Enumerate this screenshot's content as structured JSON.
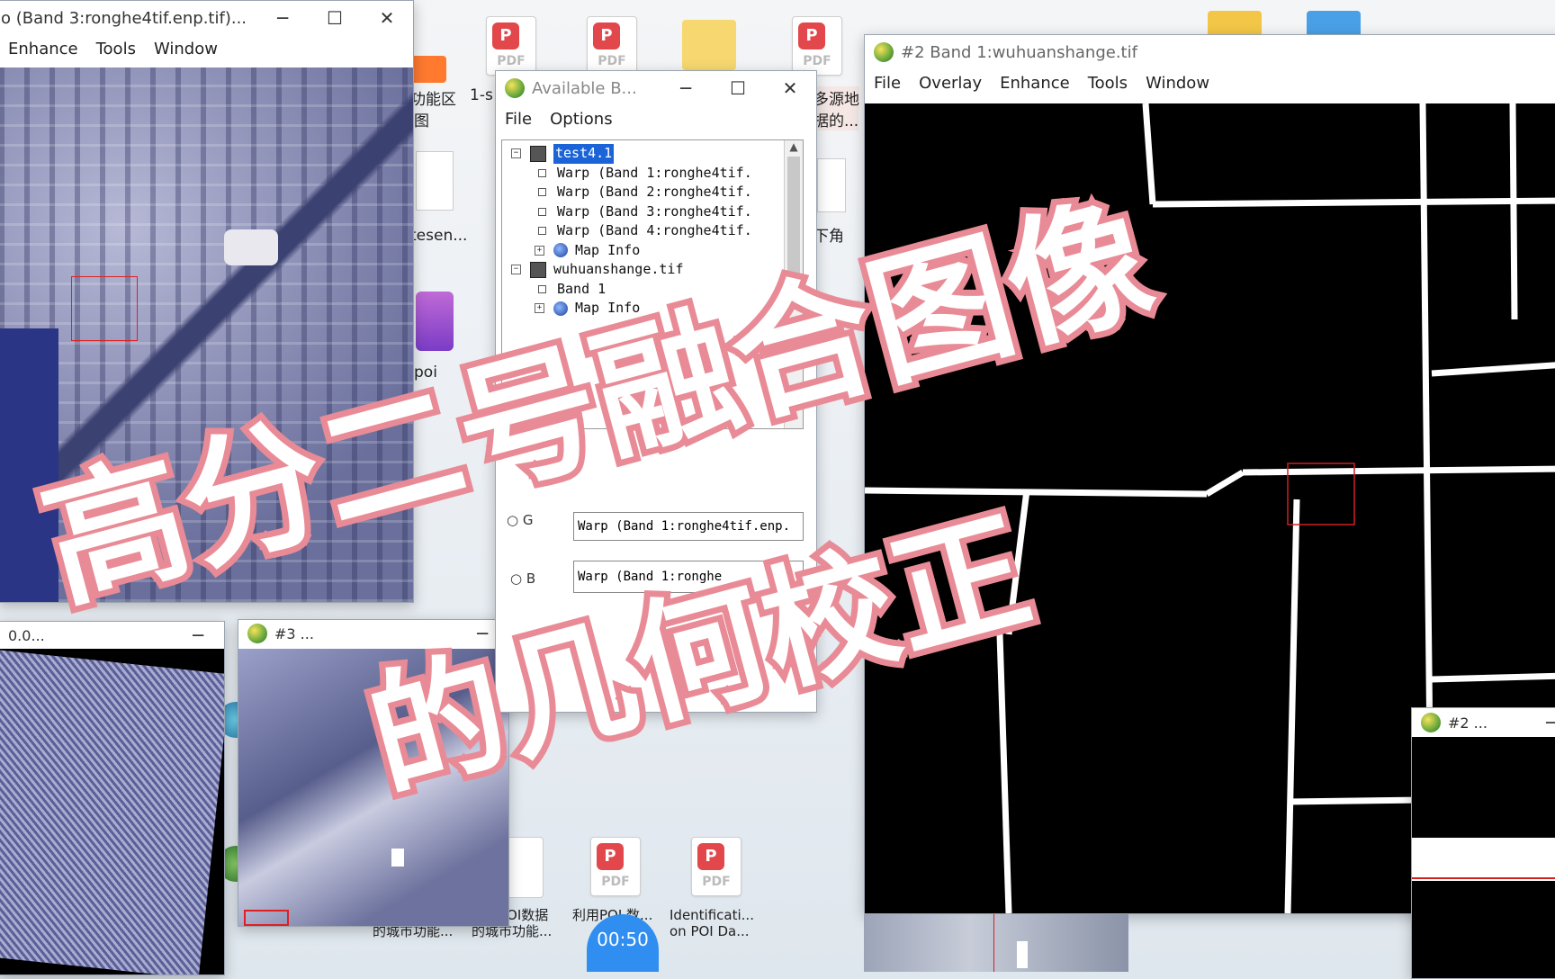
{
  "desktop": {
    "icons_top": [
      {
        "label": "1-s",
        "kind": "pdf"
      },
      {
        "label": "",
        "kind": "pdf"
      },
      {
        "label": "",
        "kind": "folder"
      },
      {
        "label": "",
        "kind": "pdf"
      }
    ],
    "icon_labels": {
      "gongneng": "功能区",
      "tu": "图",
      "tesen": "tesen...",
      "poi": "poi",
      "duoyuan": "多源地",
      "ju": "据的...",
      "xiajiao": "下角",
      "bottom1": "基于POI数据 的城市功能...",
      "bottom2": "基于POI数据 的城市功能...",
      "bottom3": "利用POI 数...",
      "bottom4": "Identificati... on POI Da..."
    },
    "pdf_label": "PDF",
    "badge_glyph": "P"
  },
  "window_band3": {
    "title": "o (Band 3:ronghe4tif.enp.tif)...",
    "menu": [
      "Enhance",
      "Tools",
      "Window"
    ]
  },
  "available_bands": {
    "title": "Available B...",
    "menu": [
      "File",
      "Options"
    ],
    "tree": [
      {
        "label": "test4.1",
        "level": 0,
        "selected": true,
        "icon": "file"
      },
      {
        "label": "Warp (Band 1:ronghe4tif.",
        "level": 1
      },
      {
        "label": "Warp (Band 2:ronghe4tif.",
        "level": 1
      },
      {
        "label": "Warp (Band 3:ronghe4tif.",
        "level": 1
      },
      {
        "label": "Warp (Band 4:ronghe4tif.",
        "level": 1
      },
      {
        "label": "Map Info",
        "level": 1,
        "icon": "globe"
      },
      {
        "label": "wuhuanshange.tif",
        "level": 0,
        "icon": "file"
      },
      {
        "label": "Band 1",
        "level": 1
      },
      {
        "label": "Map Info",
        "level": 1,
        "icon": "globe"
      }
    ],
    "fields": [
      {
        "radio": "G",
        "value": "Warp (Band 1:ronghe4tif.enp."
      },
      {
        "radio": "B",
        "value": "Warp (Band 1:ronghe"
      }
    ]
  },
  "window_wuhuan": {
    "title": "#2 Band 1:wuhuanshange.tif",
    "menu": [
      "File",
      "Overlay",
      "Enhance",
      "Tools",
      "Window"
    ]
  },
  "window_small_3": {
    "title": "#3 ..."
  },
  "window_small_2": {
    "title": "#2 ..."
  },
  "window_left_small": {
    "title": "0.0..."
  },
  "overlay": {
    "line1": "高分二号融合图像",
    "line2": "的几何校正"
  },
  "player": {
    "time": "00:50"
  },
  "colors": {
    "accent": "#e88b96",
    "timer": "#2f8ef0",
    "selection": "#1a64d8",
    "pdf": "#e2474b"
  }
}
